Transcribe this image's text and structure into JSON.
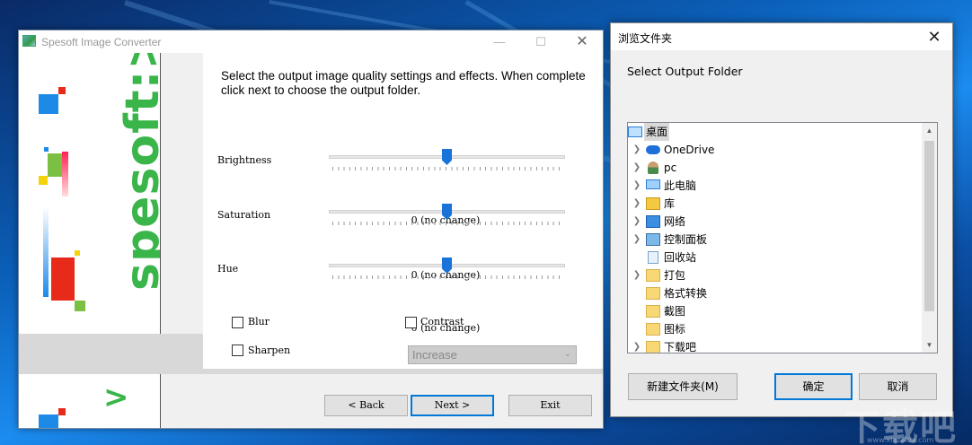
{
  "converter": {
    "title": "Spesoft Image Converter",
    "brand_text": "spesoft:>",
    "brand_caret": ">",
    "instructions": "Select the output image quality settings and effects. When complete click next to choose the output folder.",
    "sliders": [
      {
        "label": "Brightness",
        "value": 0,
        "value_text": "0 (no change)"
      },
      {
        "label": "Saturation",
        "value": 0,
        "value_text": "0 (no change)"
      },
      {
        "label": "Hue",
        "value": 0,
        "value_text": "0 (no change)"
      }
    ],
    "checkboxes": {
      "blur": {
        "label": "Blur",
        "checked": false
      },
      "contrast": {
        "label": "Contrast",
        "checked": false
      },
      "sharpen": {
        "label": "Sharpen",
        "checked": false
      }
    },
    "contrast_select": {
      "value": "Increase"
    },
    "buttons": {
      "back": "< Back",
      "next": "Next >",
      "exit": "Exit"
    }
  },
  "folder_dialog": {
    "title": "浏览文件夹",
    "prompt": "Select Output Folder",
    "tree": [
      {
        "label": "桌面",
        "icon": "desktop-icon",
        "expandable": false,
        "selected": true
      },
      {
        "label": "OneDrive",
        "icon": "cloud-icon",
        "expandable": true
      },
      {
        "label": "pc",
        "icon": "user-icon",
        "expandable": true
      },
      {
        "label": "此电脑",
        "icon": "computer-icon",
        "expandable": true
      },
      {
        "label": "库",
        "icon": "library-icon",
        "expandable": true
      },
      {
        "label": "网络",
        "icon": "network-icon",
        "expandable": true
      },
      {
        "label": "控制面板",
        "icon": "control-panel-icon",
        "expandable": true
      },
      {
        "label": "回收站",
        "icon": "recycle-bin-icon",
        "expandable": false
      },
      {
        "label": "打包",
        "icon": "folder-icon",
        "expandable": true
      },
      {
        "label": "格式转换",
        "icon": "folder-icon",
        "expandable": false
      },
      {
        "label": "截图",
        "icon": "folder-icon",
        "expandable": false
      },
      {
        "label": "图标",
        "icon": "folder-icon",
        "expandable": false
      },
      {
        "label": "下载吧",
        "icon": "folder-icon",
        "expandable": true
      }
    ],
    "buttons": {
      "new_folder": "新建文件夹(M)",
      "ok": "确定",
      "cancel": "取消"
    }
  },
  "watermark": {
    "text": "下载吧",
    "sub": "www.xiazaiba.com"
  },
  "colors": {
    "accent": "#0078d7",
    "brand_green": "#3ab54a",
    "slider_thumb": "#1a73d9"
  }
}
